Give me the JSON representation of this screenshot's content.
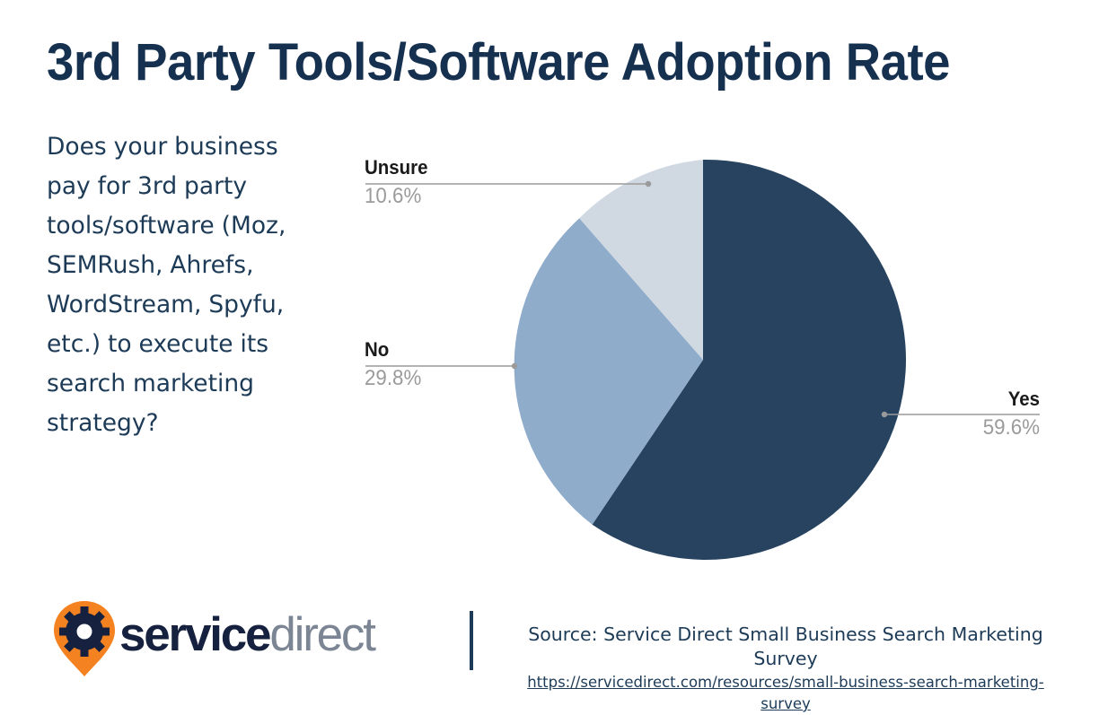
{
  "title": "3rd Party Tools/Software Adoption Rate",
  "question": "Does your business pay for 3rd party tools/software (Moz, SEMRush, Ahrefs, WordStream, Spyfu, etc.) to execute its search marketing strategy?",
  "chart_data": {
    "type": "pie",
    "title": "3rd Party Tools/Software Adoption Rate",
    "categories": [
      "Yes",
      "No",
      "Unsure"
    ],
    "values": [
      59.6,
      29.8,
      10.6
    ],
    "value_labels": [
      "59.6%",
      "29.8%",
      "10.6%"
    ],
    "colors": [
      "#27435f",
      "#8facca",
      "#d0d9e2"
    ],
    "unit": "percent",
    "start_angle_deg": 0,
    "direction": "clockwise",
    "legend": "none",
    "labels_position": "outside-callout",
    "slices": [
      {
        "label": "Yes",
        "value": 59.6,
        "value_label": "59.6%",
        "color": "#27435f"
      },
      {
        "label": "No",
        "value": 29.8,
        "value_label": "29.8%",
        "color": "#8facca"
      },
      {
        "label": "Unsure",
        "value": 10.6,
        "value_label": "10.6%",
        "color": "#d0d9e2"
      }
    ]
  },
  "logo": {
    "brand_primary": "service",
    "brand_secondary": "direct",
    "pin_color": "#f58220",
    "gear_color": "#16213f"
  },
  "footer": {
    "source": "Source: Service Direct Small Business Search Marketing Survey",
    "url": "https://servicedirect.com/resources/small-business-search-marketing-survey"
  },
  "theme": {
    "title_color": "#16304f",
    "question_color": "#1d3b57",
    "label_color": "#1a1a1a",
    "percent_color": "#9b9b9b",
    "leader_color": "#9a9a9a"
  }
}
